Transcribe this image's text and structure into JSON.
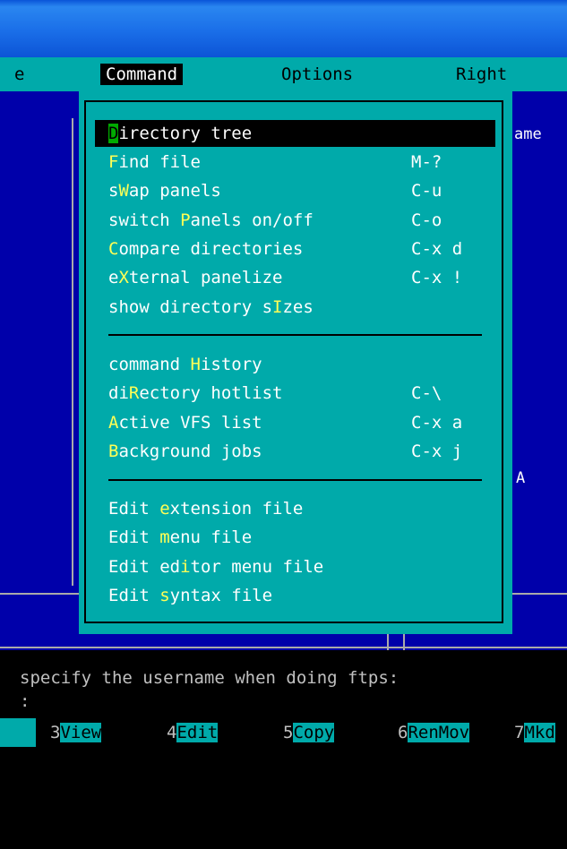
{
  "menubar": {
    "items": [
      "e",
      "Command",
      "Options",
      "Right"
    ]
  },
  "right_panel": {
    "header_text": "ame",
    "marker_text": "A"
  },
  "command_menu": {
    "items": [
      {
        "pre": "",
        "hotkey": "D",
        "post": "irectory tree",
        "shortcut": ""
      },
      {
        "pre": "",
        "hotkey": "F",
        "post": "ind file",
        "shortcut": "M-?"
      },
      {
        "pre": "s",
        "hotkey": "W",
        "post": "ap panels",
        "shortcut": "C-u"
      },
      {
        "pre": "switch ",
        "hotkey": "P",
        "post": "anels on/off",
        "shortcut": "C-o"
      },
      {
        "pre": "",
        "hotkey": "C",
        "post": "ompare directories",
        "shortcut": "C-x d"
      },
      {
        "pre": "e",
        "hotkey": "X",
        "post": "ternal panelize",
        "shortcut": "C-x !"
      },
      {
        "pre": "show directory s",
        "hotkey": "I",
        "post": "zes",
        "shortcut": ""
      },
      {
        "pre": "command ",
        "hotkey": "H",
        "post": "istory",
        "shortcut": ""
      },
      {
        "pre": "di",
        "hotkey": "R",
        "post": "ectory hotlist",
        "shortcut": "C-\\"
      },
      {
        "pre": "",
        "hotkey": "A",
        "post": "ctive VFS list",
        "shortcut": "C-x a"
      },
      {
        "pre": "",
        "hotkey": "B",
        "post": "ackground jobs",
        "shortcut": "C-x j"
      },
      {
        "pre": "Edit ",
        "hotkey": "e",
        "post": "xtension file",
        "shortcut": ""
      },
      {
        "pre": "Edit ",
        "hotkey": "m",
        "post": "enu file",
        "shortcut": ""
      },
      {
        "pre": "Edit ed",
        "hotkey": "i",
        "post": "tor menu file",
        "shortcut": ""
      },
      {
        "pre": "Edit ",
        "hotkey": "s",
        "post": "yntax file",
        "shortcut": ""
      }
    ]
  },
  "status": {
    "line1": "specify the username when doing ftps:",
    "line2": ":"
  },
  "fkeys": [
    {
      "num": "3",
      "label": "View"
    },
    {
      "num": "4",
      "label": "Edit"
    },
    {
      "num": "5",
      "label": "Copy"
    },
    {
      "num": "6",
      "label": "RenMov"
    },
    {
      "num": "7",
      "label": "Mkd"
    }
  ],
  "colors": {
    "panel_bg": "#0000aa",
    "menu_bg": "#00aaaa",
    "hotkey": "#ffff55",
    "selected_hotkey_bg": "#00aa00"
  }
}
